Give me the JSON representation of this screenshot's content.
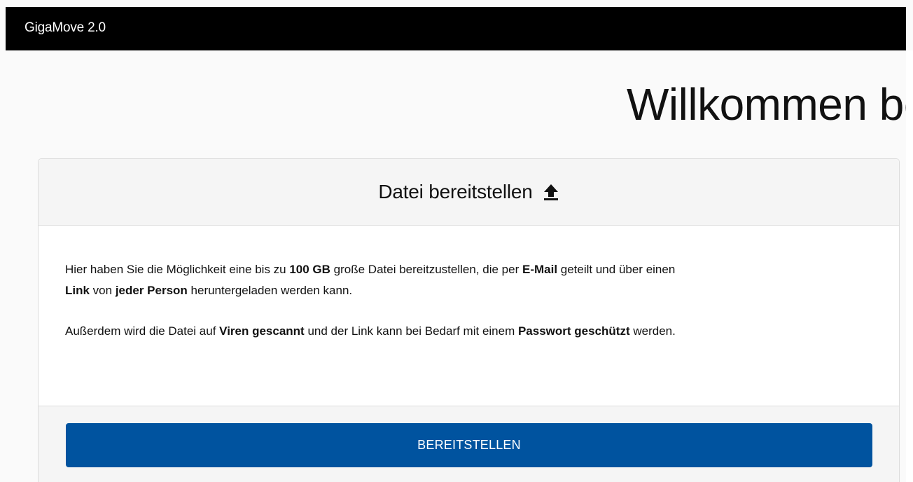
{
  "navbar": {
    "brand": "GigaMove 2.0"
  },
  "page": {
    "title": "Willkommen be"
  },
  "card": {
    "title": "Datei bereitstellen",
    "icon": "upload-icon",
    "paragraph1": {
      "t1": "Hier haben Sie die Möglichkeit eine bis zu ",
      "b1": "100 GB",
      "t2": " große Datei bereitzustellen, die per ",
      "b2": "E-Mail",
      "t3": " geteilt und über einen ",
      "b3": "Link",
      "t4": " von ",
      "b4": "jeder Person",
      "t5": " heruntergeladen werden kann."
    },
    "paragraph2": {
      "t1": "Außerdem wird die Datei auf ",
      "b1": "Viren gescannt",
      "t2": " und der Link kann bei Bedarf mit einem ",
      "b2": "Passwort geschützt",
      "t3": " werden."
    },
    "button_label": "BEREITSTELLEN"
  },
  "colors": {
    "navbar": "#000000",
    "button": "#00539f",
    "card_header": "#f5f5f5"
  }
}
